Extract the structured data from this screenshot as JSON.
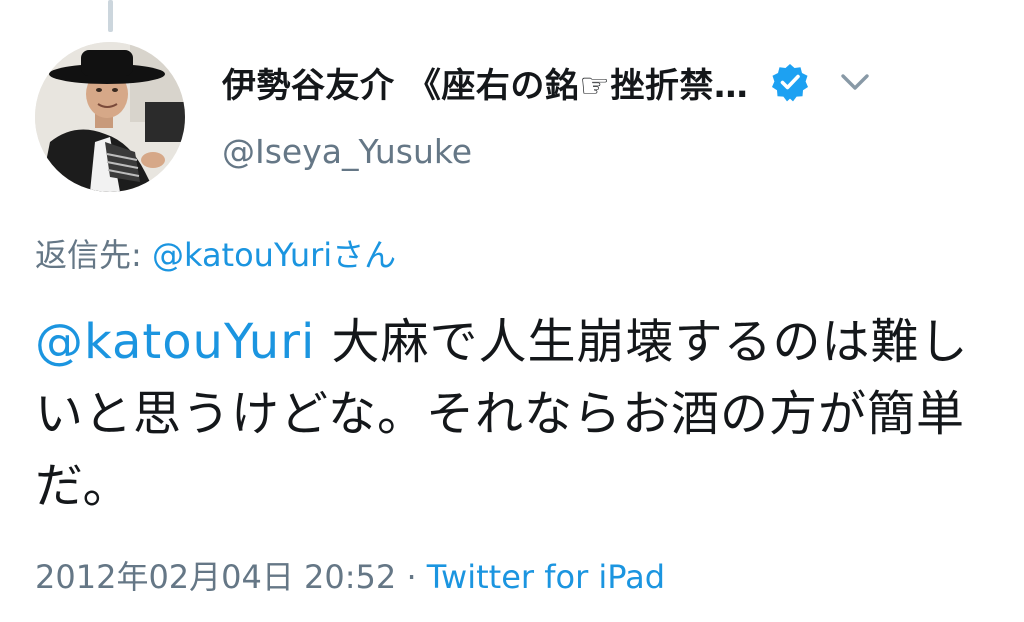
{
  "tweet": {
    "author": {
      "display_name": "伊勢谷友介 《座右の銘☞挫折禁…",
      "handle": "@Iseya_Yusuke",
      "verified": true,
      "avatar_icon": "profile-photo"
    },
    "reply": {
      "prefix": "返信先: ",
      "mention": "@katouYuri",
      "suffix": "さん"
    },
    "text": {
      "mention": "@katouYuri",
      "body": " 大麻で人生崩壊するのは難しいと思うけどな。それならお酒の方が簡単だ。"
    },
    "timestamp": "2012年02月04日 20:52",
    "separator": " · ",
    "source": "Twitter for iPad"
  },
  "icons": {
    "verified": "verified-badge-icon",
    "menu": "chevron-down-icon"
  },
  "colors": {
    "text": "#14171a",
    "secondary": "#657786",
    "link": "#1b95e0",
    "verified": "#1da1f2",
    "thread_line": "#ccd6dd"
  }
}
